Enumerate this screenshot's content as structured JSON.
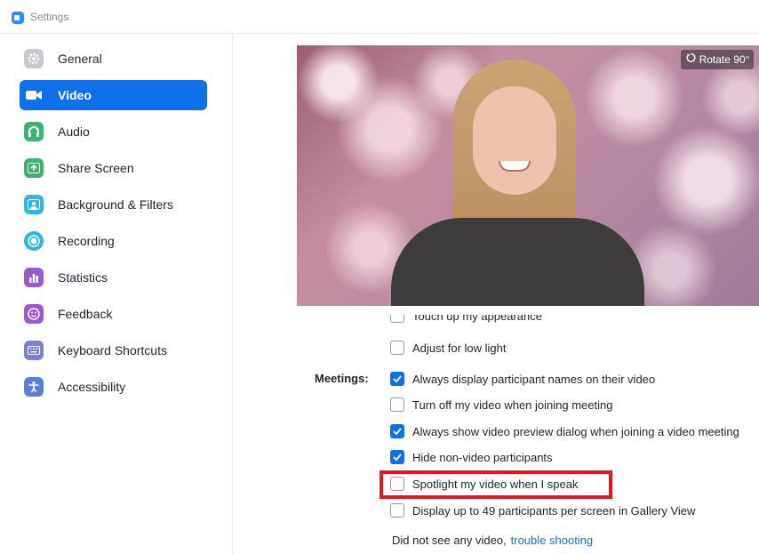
{
  "window": {
    "title": "Settings"
  },
  "sidebar": {
    "items": [
      {
        "label": "General",
        "icon": "gear-icon",
        "color": "#c8c8cf",
        "active": false
      },
      {
        "label": "Video",
        "icon": "video-camera-icon",
        "color": "#0e71eb",
        "active": true
      },
      {
        "label": "Audio",
        "icon": "headphones-icon",
        "color": "#3cb371",
        "active": false
      },
      {
        "label": "Share Screen",
        "icon": "share-screen-icon",
        "color": "#3cb371",
        "active": false
      },
      {
        "label": "Background & Filters",
        "icon": "person-background-icon",
        "color": "#2db6e8",
        "active": false
      },
      {
        "label": "Recording",
        "icon": "record-icon",
        "color": "#2db6e8",
        "active": false
      },
      {
        "label": "Statistics",
        "icon": "bar-chart-icon",
        "color": "#9b59d0",
        "active": false
      },
      {
        "label": "Feedback",
        "icon": "smiley-icon",
        "color": "#9b59d0",
        "active": false
      },
      {
        "label": "Keyboard Shortcuts",
        "icon": "keyboard-icon",
        "color": "#7b7fd6",
        "active": false
      },
      {
        "label": "Accessibility",
        "icon": "accessibility-icon",
        "color": "#5b7fd6",
        "active": false
      }
    ]
  },
  "preview": {
    "rotate_label": "Rotate 90°",
    "rotate_icon": "rotate-icon"
  },
  "options": {
    "partial_item": {
      "label": "Touch up my appearance",
      "checked": false
    },
    "adjust_light": {
      "label": "Adjust for low light",
      "checked": false
    },
    "meetings_label": "Meetings:",
    "meeting_items": [
      {
        "label": "Always display participant names on their video",
        "checked": true
      },
      {
        "label": "Turn off my video when joining meeting",
        "checked": false
      },
      {
        "label": "Always show video preview dialog when joining a video meeting",
        "checked": true
      },
      {
        "label": "Hide non-video participants",
        "checked": true
      },
      {
        "label": "Spotlight my video when I speak",
        "checked": false,
        "highlighted": true
      },
      {
        "label": "Display up to 49 participants per screen in Gallery View",
        "checked": false
      }
    ]
  },
  "footer": {
    "text": "Did not see any video,",
    "link": "trouble shooting"
  },
  "colors": {
    "accent": "#0e71eb",
    "highlight": "#e8141b"
  }
}
